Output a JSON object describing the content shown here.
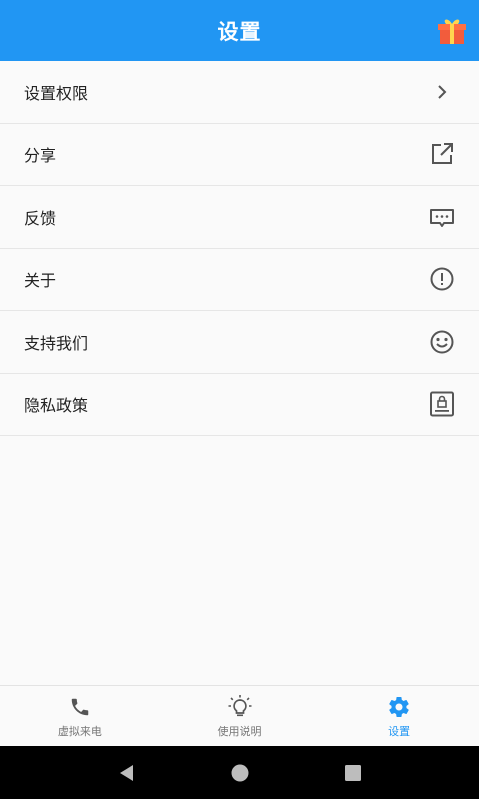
{
  "appbar": {
    "title": "设置",
    "color": "#2196f3",
    "gift_icon": "gift-icon"
  },
  "settings": {
    "items": [
      {
        "label": "设置权限",
        "icon": "chevron-right-icon"
      },
      {
        "label": "分享",
        "icon": "external-link-icon"
      },
      {
        "label": "反馈",
        "icon": "message-icon"
      },
      {
        "label": "关于",
        "icon": "info-alert-icon"
      },
      {
        "label": "支持我们",
        "icon": "smiley-icon"
      },
      {
        "label": "隐私政策",
        "icon": "lock-document-icon"
      }
    ]
  },
  "bottom_nav": {
    "active_color": "#2196f3",
    "items": [
      {
        "label": "虚拟来电",
        "icon": "phone-icon",
        "active": false
      },
      {
        "label": "使用说明",
        "icon": "lightbulb-icon",
        "active": false
      },
      {
        "label": "设置",
        "icon": "gear-icon",
        "active": true
      }
    ]
  },
  "system_nav": {
    "buttons": [
      "back-icon",
      "home-icon",
      "recents-icon"
    ]
  }
}
